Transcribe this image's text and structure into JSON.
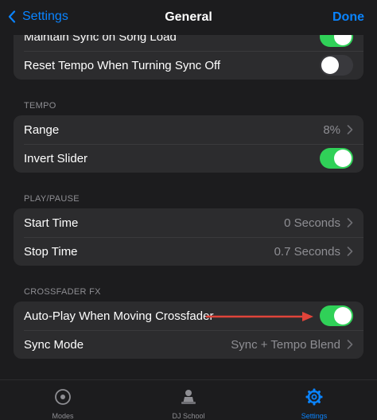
{
  "nav": {
    "back_label": "Settings",
    "title": "General",
    "done_label": "Done"
  },
  "sync_group": {
    "rows": [
      {
        "label": "Maintain Sync on Song Load",
        "toggle": "on"
      },
      {
        "label": "Reset Tempo When Turning Sync Off",
        "toggle": "off"
      }
    ]
  },
  "tempo": {
    "header": "TEMPO",
    "range": {
      "label": "Range",
      "value": "8%"
    },
    "invert": {
      "label": "Invert Slider",
      "toggle": "on"
    }
  },
  "playpause": {
    "header": "PLAY/PAUSE",
    "start": {
      "label": "Start Time",
      "value": "0 Seconds"
    },
    "stop": {
      "label": "Stop Time",
      "value": "0.7 Seconds"
    }
  },
  "crossfader": {
    "header": "CROSSFADER FX",
    "autoplay": {
      "label": "Auto-Play When Moving Crossfader",
      "toggle": "on"
    },
    "syncmode": {
      "label": "Sync Mode",
      "value": "Sync + Tempo Blend"
    }
  },
  "tabs": [
    {
      "label": "Modes",
      "icon": "modes-icon",
      "active": false
    },
    {
      "label": "DJ School",
      "icon": "dj-school-icon",
      "active": false
    },
    {
      "label": "Settings",
      "icon": "gear-icon",
      "active": true
    }
  ],
  "colors": {
    "accent": "#0a84ff",
    "toggle_on": "#30d158",
    "arrow": "#e0443a"
  }
}
